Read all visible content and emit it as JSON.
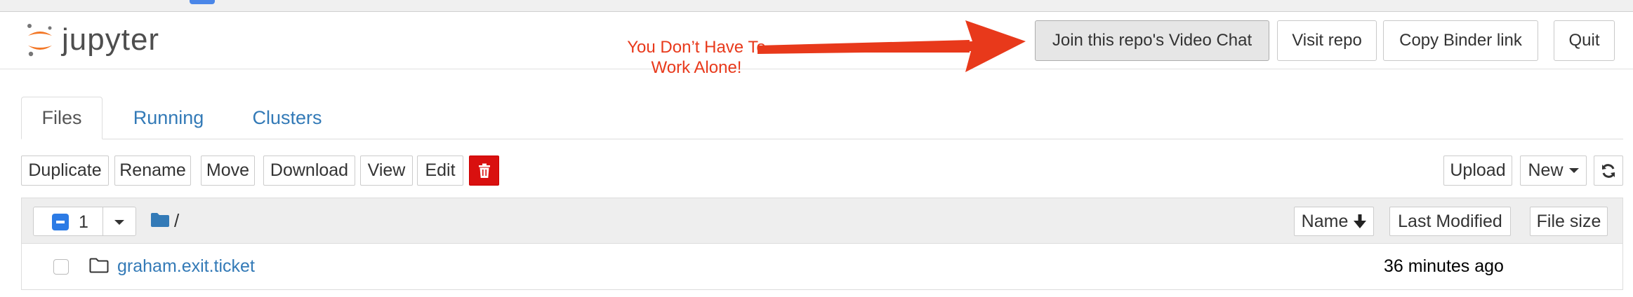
{
  "header": {
    "logo_text": "jupyter",
    "annotation_line1": "You Don’t Have To",
    "annotation_line2": "Work Alone!",
    "buttons": {
      "video_chat": "Join this repo's Video Chat",
      "visit_repo": "Visit repo",
      "copy_binder": "Copy Binder link",
      "quit": "Quit"
    }
  },
  "tabs": [
    "Files",
    "Running",
    "Clusters"
  ],
  "toolbar": {
    "duplicate": "Duplicate",
    "rename": "Rename",
    "move": "Move",
    "download": "Download",
    "view": "View",
    "edit": "Edit",
    "upload": "Upload",
    "new": "New"
  },
  "list_header": {
    "selected_count": "1",
    "path": "/",
    "sort_name": "Name",
    "last_modified": "Last Modified",
    "file_size": "File size"
  },
  "rows": [
    {
      "name": "graham.exit.ticket",
      "modified": "36 minutes ago"
    }
  ],
  "colors": {
    "accent_link": "#337ab7",
    "annotation": "#e8391b",
    "delete": "#d9100f",
    "logo_orange": "#f37726"
  }
}
